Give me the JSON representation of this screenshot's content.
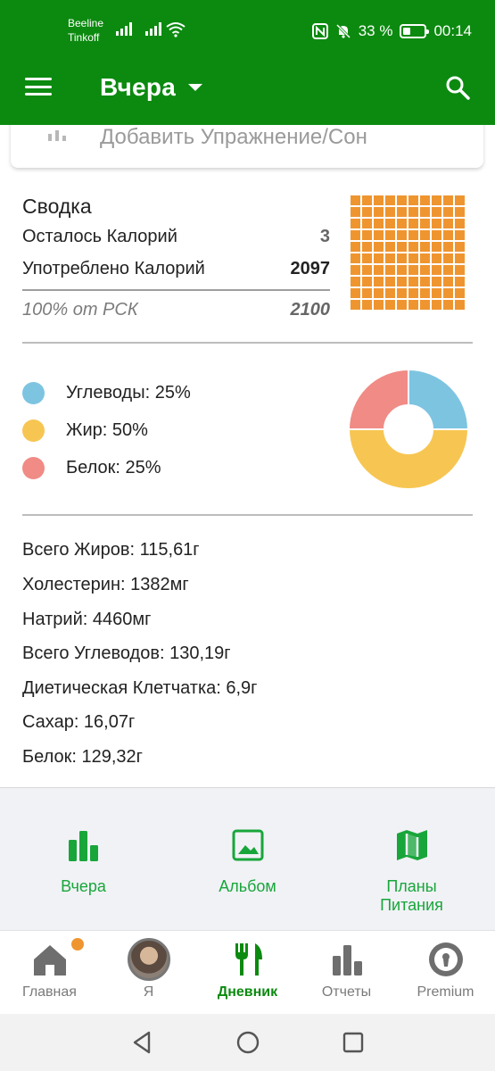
{
  "status_bar": {
    "carrier_1": "Beeline",
    "carrier_2": "Tinkoff",
    "battery_text": "33 %",
    "battery_level": 0.33,
    "time": "00:14",
    "icons": [
      "signal-icon",
      "wifi-icon",
      "nfc-icon",
      "mute-icon",
      "battery-icon"
    ]
  },
  "app_bar": {
    "menu_icon": "hamburger-menu-icon",
    "date_label": "Вчера",
    "dropdown_icon": "caret-down-icon",
    "search_icon": "search-icon"
  },
  "partial_card": {
    "text": "Добавить Упражнение/Сон"
  },
  "summary": {
    "title": "Сводка",
    "remaining_label": "Осталось Калорий",
    "remaining_value": "3",
    "consumed_label": "Употреблено Калорий",
    "consumed_value": "2097",
    "rdi_label": "100% от РСК",
    "rdi_value": "2100",
    "waffle": {
      "filled_fraction": 1.0,
      "color": "#ef9530"
    }
  },
  "macros": {
    "items": [
      {
        "label": "Углеводы: 25%",
        "percent": 25,
        "color": "#7dc4e1"
      },
      {
        "label": "Жир: 50%",
        "percent": 50,
        "color": "#f7c652"
      },
      {
        "label": "Белок: 25%",
        "percent": 25,
        "color": "#f08b86"
      }
    ]
  },
  "nutrients": [
    "Всего Жиров: 115,61г",
    "Холестерин: 1382мг",
    "Натрий: 4460мг",
    "Всего Углеводов: 130,19г",
    "Диетическая Клетчатка: 6,9г",
    "Сахар: 16,07г",
    "Белок: 129,32г"
  ],
  "shortcuts": [
    {
      "label": "Вчера",
      "icon": "bar-chart-icon"
    },
    {
      "label": "Альбом",
      "icon": "image-icon"
    },
    {
      "label": "Планы\nПитания",
      "icon": "map-icon"
    }
  ],
  "bottom_nav": {
    "items": [
      {
        "label": "Главная",
        "icon": "home-icon"
      },
      {
        "label": "Я",
        "icon": "avatar"
      },
      {
        "label": "Дневник",
        "icon": "fork-knife-icon",
        "active": true
      },
      {
        "label": "Отчеты",
        "icon": "bar-chart-icon"
      },
      {
        "label": "Premium",
        "icon": "premium-badge-icon"
      }
    ]
  },
  "colors": {
    "brand_green": "#0c8a10",
    "accent_green": "#18a63a",
    "orange": "#ef9530"
  }
}
